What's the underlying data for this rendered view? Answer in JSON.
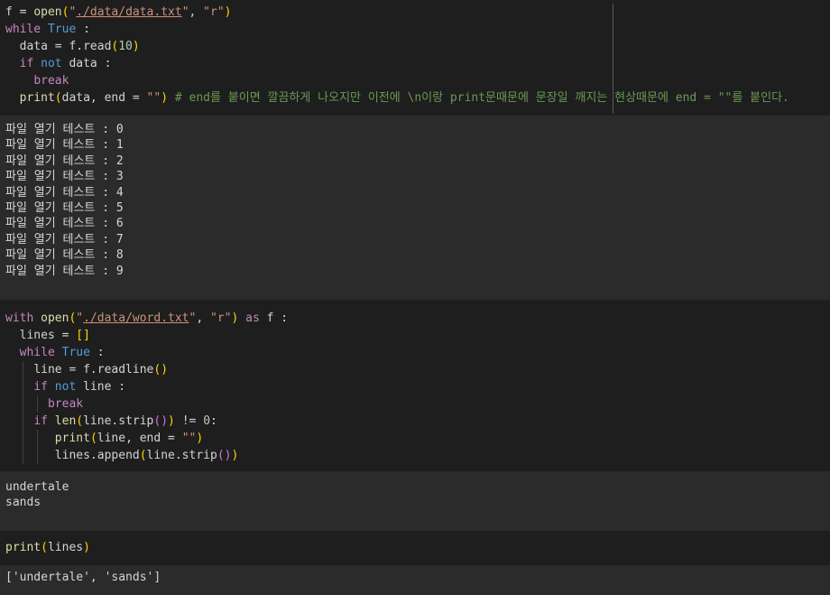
{
  "cell1": {
    "l1": {
      "a": "f = ",
      "open": "open",
      "p": "(",
      "q1": "\"",
      "path": "./data/data.txt",
      "q2": "\"",
      "sep": ", ",
      "mode": "\"r\"",
      "p2": ")"
    },
    "l2": {
      "while": "while",
      "true": "True",
      "rest": " :"
    },
    "l3": {
      "a": "data = f.read",
      "p": "(",
      "n": "10",
      "p2": ")"
    },
    "l4": {
      "if": "if",
      "sp": " ",
      "not": "not",
      "rest": " data :"
    },
    "l5": {
      "brk": "break"
    },
    "l6": {
      "print": "print",
      "p": "(",
      "args": "data, end = ",
      "s": "\"\"",
      "p2": ")",
      "cm": " # end를 붙이면 깔끔하게 나오지만 이전에 \\n이랑 print문때문에 문장일 깨지는 현상때문에 end = \"\"를 붙인다."
    }
  },
  "output1": [
    "파일 열기 테스트 : 0",
    "파일 열기 테스트 : 1",
    "파일 열기 테스트 : 2",
    "파일 열기 테스트 : 3",
    "파일 열기 테스트 : 4",
    "파일 열기 테스트 : 5",
    "파일 열기 테스트 : 6",
    "파일 열기 테스트 : 7",
    "파일 열기 테스트 : 8",
    "파일 열기 테스트 : 9"
  ],
  "cell2": {
    "l1": {
      "with": "with",
      "sp": " ",
      "open": "open",
      "p": "(",
      "q1": "\"",
      "path": "./data/word.txt",
      "q2": "\"",
      "sep": ", ",
      "mode": "\"r\"",
      "p2": ")",
      "as": "as",
      "rest": " f :"
    },
    "l2": {
      "a": "lines = ",
      "br": "[]"
    },
    "l3": {
      "while": "while",
      "true": "True",
      "rest": " :"
    },
    "l4": {
      "a": "line = f.readline",
      "p": "()"
    },
    "l5": {
      "if": "if",
      "not": "not",
      "rest": " line :"
    },
    "l6": {
      "brk": "break"
    },
    "l7": {
      "if": "if",
      "len": "len",
      "p": "(",
      "a": "line.strip",
      "pp": "()",
      "p2": ")",
      "ne": " != ",
      "n": "0",
      "c": ":"
    },
    "l8": {
      "print": "print",
      "p": "(",
      "a": "line, end = ",
      "s": "\"\"",
      "p2": ")"
    },
    "l9": {
      "a": "lines.append",
      "p": "(",
      "b": "line.strip",
      "pp": "()",
      "p2": ")"
    }
  },
  "output2": [
    "undertale",
    "sands"
  ],
  "cell3": {
    "print": "print",
    "p": "(",
    "a": "lines",
    "p2": ")"
  },
  "output3": "['undertale', 'sands']"
}
